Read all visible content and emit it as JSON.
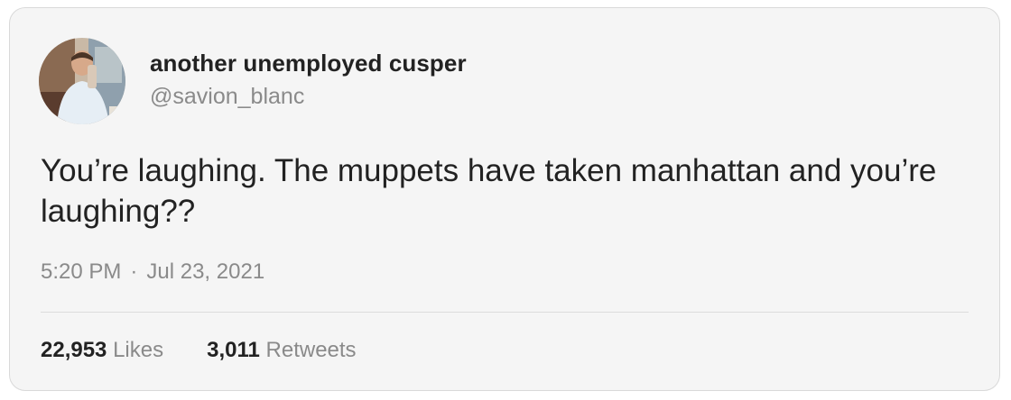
{
  "tweet": {
    "author": {
      "display_name": "another unemployed cusper",
      "handle": "@savion_blanc",
      "avatar_icon": "profile-photo"
    },
    "text": "You’re laughing. The muppets have taken manhattan and you’re laughing??",
    "time": "5:20 PM",
    "separator": "·",
    "date": "Jul 23, 2021",
    "stats": {
      "likes_count": "22,953",
      "likes_label": "Likes",
      "retweets_count": "3,011",
      "retweets_label": "Retweets"
    }
  },
  "colors": {
    "card_background": "#f5f5f5",
    "text_primary": "#222222",
    "text_secondary": "#8a8a8a",
    "border": "#d9d9d9"
  }
}
